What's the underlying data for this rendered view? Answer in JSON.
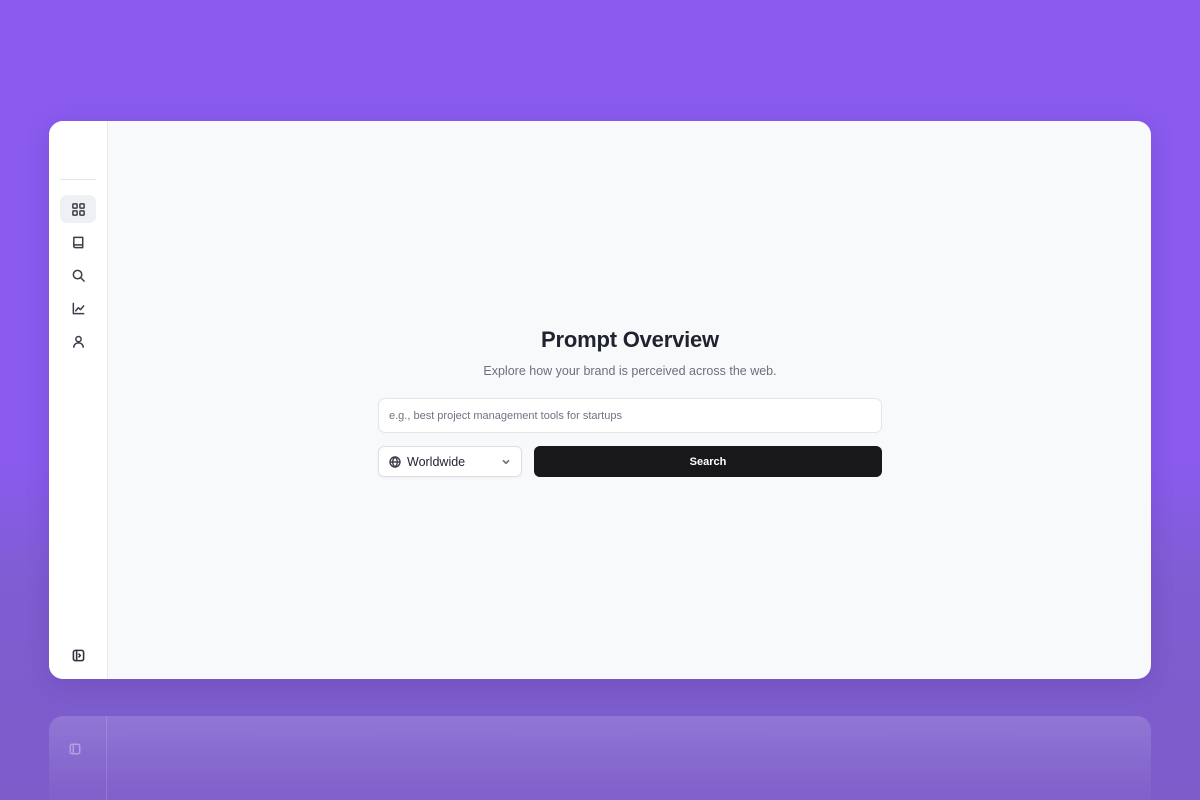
{
  "sidebar": {
    "items": [
      {
        "name": "dashboard",
        "icon": "grid-icon",
        "active": true
      },
      {
        "name": "library",
        "icon": "book-icon",
        "active": false
      },
      {
        "name": "search",
        "icon": "search-icon",
        "active": false
      },
      {
        "name": "analytics",
        "icon": "line-chart-icon",
        "active": false
      },
      {
        "name": "profile",
        "icon": "user-icon",
        "active": false
      }
    ],
    "collapse_icon": "sidebar-toggle-icon"
  },
  "main": {
    "title": "Prompt Overview",
    "subtitle": "Explore how your brand is perceived across the web.",
    "search": {
      "value": "",
      "placeholder": "e.g., best project management tools for startups"
    },
    "region": {
      "selected": "Worldwide",
      "icon": "globe-icon"
    },
    "search_button_label": "Search"
  },
  "colors": {
    "background": "#8a5bee",
    "window": "#f8f9fb",
    "sidebar": "#ffffff",
    "primary_button": "#18181b"
  }
}
